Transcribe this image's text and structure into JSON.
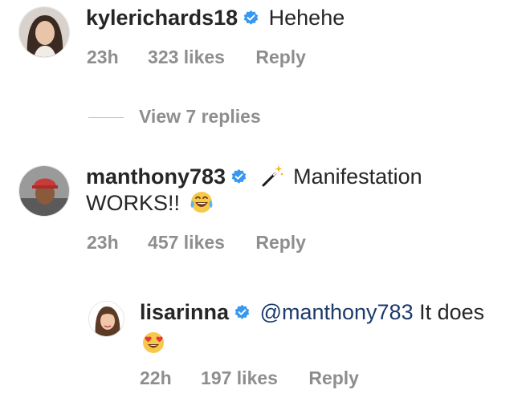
{
  "comments": [
    {
      "username": "kylerichards18",
      "text": "Hehehe",
      "time": "23h",
      "likes": "323 likes",
      "reply": "Reply",
      "avatar_icon": "avatar-woman-dark-hair"
    },
    {
      "view_replies": "View 7 replies"
    },
    {
      "username": "manthony783",
      "text_line1": "Manifestation",
      "text_line2": "WORKS!!",
      "emoji1": "magic-wand-emoji",
      "emoji2": "tears-of-joy-emoji",
      "time": "23h",
      "likes": "457 likes",
      "reply": "Reply",
      "avatar_icon": "avatar-man-red-cap"
    },
    {
      "username": "lisarinna",
      "mention": "@manthony783",
      "text": "It does",
      "emoji": "heart-eyes-emoji",
      "time": "22h",
      "likes": "197 likes",
      "reply": "Reply",
      "avatar_icon": "avatar-woman-cartoon"
    }
  ],
  "colors": {
    "text": "#262626",
    "meta": "#8e8e8e",
    "verified": "#3897f0",
    "mention": "#1c3a6b"
  }
}
